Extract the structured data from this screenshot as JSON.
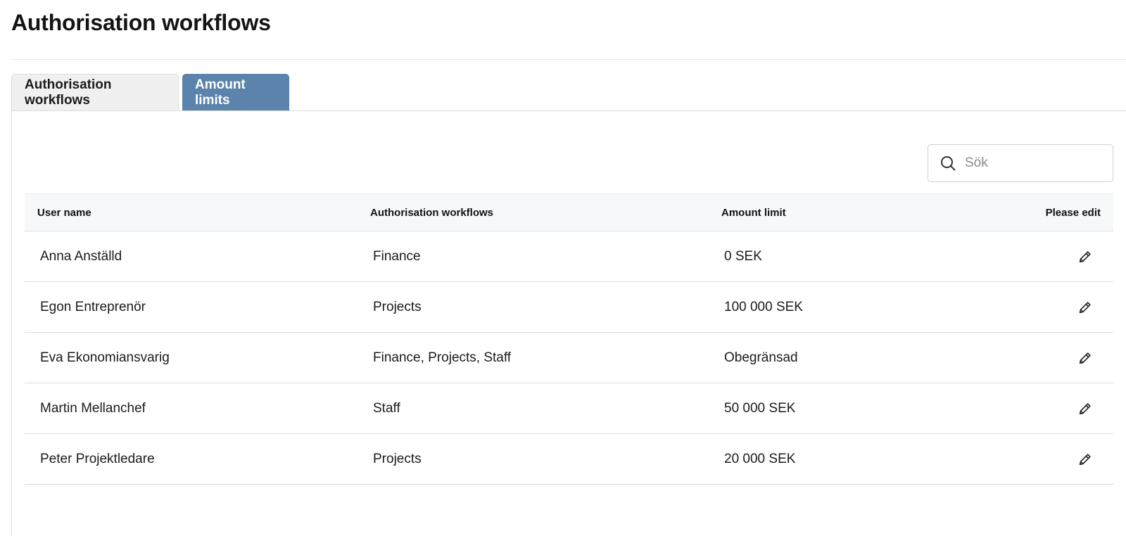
{
  "page": {
    "title": "Authorisation workflows"
  },
  "tabs": [
    {
      "label": "Authorisation workflows",
      "active": false
    },
    {
      "label": "Amount limits",
      "active": true
    }
  ],
  "search": {
    "placeholder": "Sök",
    "value": ""
  },
  "table": {
    "headers": {
      "user_name": "User name",
      "workflows": "Authorisation workflows",
      "amount_limit": "Amount limit",
      "edit": "Please edit"
    },
    "rows": [
      {
        "user_name": "Anna Anställd",
        "workflows": "Finance",
        "amount_limit": "0 SEK"
      },
      {
        "user_name": "Egon Entreprenör",
        "workflows": "Projects",
        "amount_limit": "100 000 SEK"
      },
      {
        "user_name": "Eva Ekonomiansvarig",
        "workflows": "Finance, Projects, Staff",
        "amount_limit": "Obegränsad"
      },
      {
        "user_name": "Martin Mellanchef",
        "workflows": "Staff",
        "amount_limit": "50 000 SEK"
      },
      {
        "user_name": "Peter Projektledare",
        "workflows": "Projects",
        "amount_limit": "20 000 SEK"
      }
    ]
  },
  "icons": {
    "search": "search-icon",
    "edit": "pencil-icon"
  },
  "colors": {
    "active_tab": "#5c83ab",
    "inactive_tab": "#f0f0f0",
    "header_row": "#f7f8fa"
  }
}
